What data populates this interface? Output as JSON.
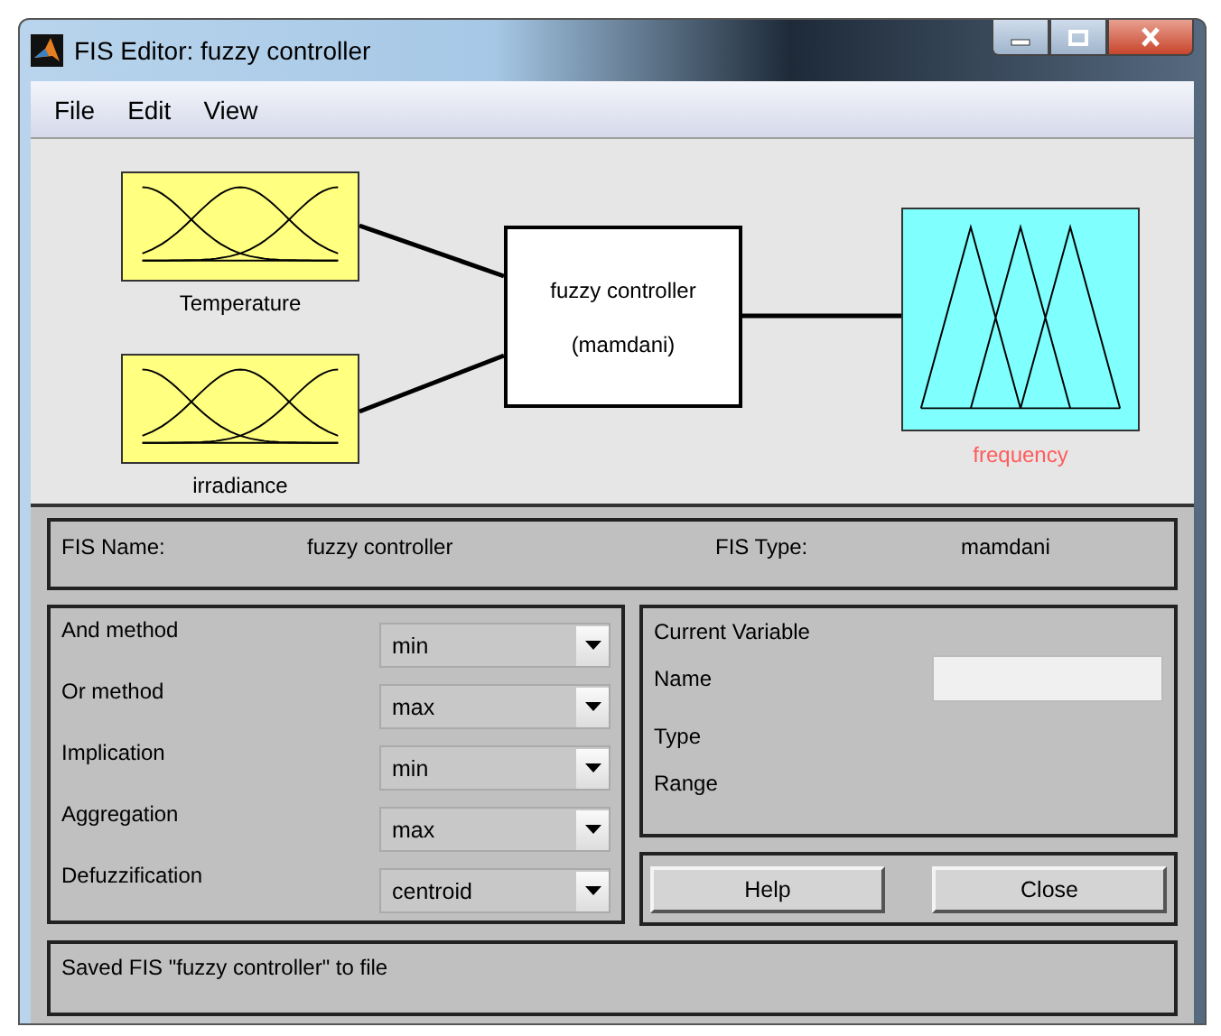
{
  "window": {
    "title": "FIS Editor: fuzzy controller"
  },
  "menu": [
    "File",
    "Edit",
    "View"
  ],
  "diagram": {
    "inputs": [
      {
        "name": "Temperature"
      },
      {
        "name": "irradiance"
      }
    ],
    "system": {
      "name": "fuzzy controller",
      "type": "(mamdani)"
    },
    "output": {
      "name": "frequency"
    }
  },
  "fis_info": {
    "name_label": "FIS Name:",
    "name": "fuzzy controller",
    "type_label": "FIS Type:",
    "type": "mamdani"
  },
  "methods": [
    {
      "label": "And method",
      "value": "min"
    },
    {
      "label": "Or method",
      "value": "max"
    },
    {
      "label": "Implication",
      "value": "min"
    },
    {
      "label": "Aggregation",
      "value": "max"
    },
    {
      "label": "Defuzzification",
      "value": "centroid"
    }
  ],
  "current_variable": {
    "title": "Current Variable",
    "fields": [
      "Name",
      "Type",
      "Range"
    ]
  },
  "buttons": [
    "Help",
    "Close"
  ],
  "status": "Saved FIS \"fuzzy controller\" to file"
}
